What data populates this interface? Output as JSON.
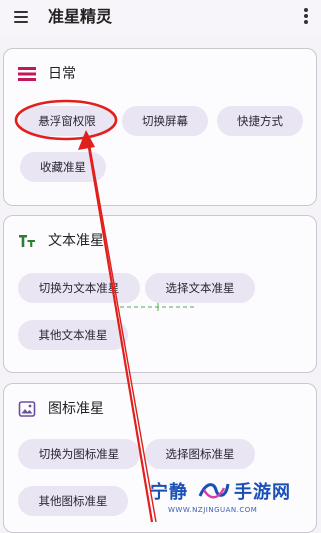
{
  "app": {
    "title": "准星精灵",
    "menu_icon": "hamburger-menu-icon",
    "more_icon": "more-vert-icon"
  },
  "sections": {
    "daily": {
      "title": "日常",
      "icon": "list-icon",
      "icon_color": "#c2185b",
      "chips": [
        "悬浮窗权限",
        "切换屏幕",
        "快捷方式",
        "收藏准星"
      ]
    },
    "text": {
      "title": "文本准星",
      "icon": "text-format-icon",
      "icon_color": "#2e7d32",
      "chips": [
        "切换为文本准星",
        "选择文本准星",
        "其他文本准星"
      ]
    },
    "icon": {
      "title": "图标准星",
      "icon": "image-icon",
      "icon_color": "#6a4fa0",
      "chips": [
        "切换为图标准星",
        "选择图标准星",
        "其他图标准星"
      ]
    }
  },
  "annotation": {
    "color": "#e0201c",
    "target": "悬浮窗权限"
  },
  "watermark": {
    "name_left": "宁静",
    "name_right": "手游网",
    "url": "WWW.NZJINGUAN.COM",
    "color": "#1a4fb6"
  }
}
